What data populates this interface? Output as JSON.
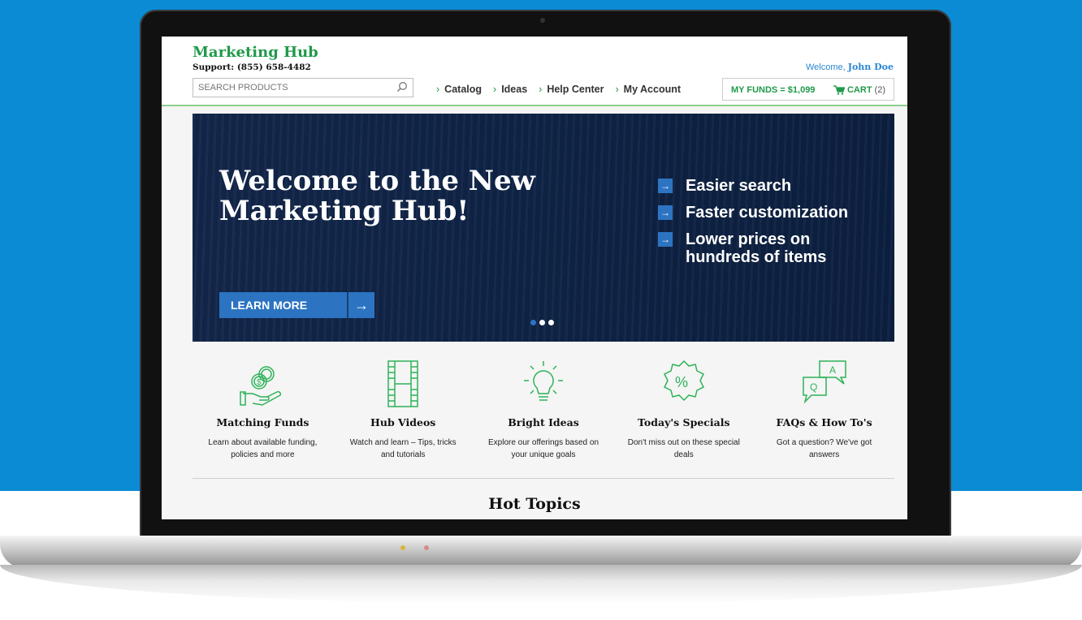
{
  "header": {
    "brand": "Marketing Hub",
    "support": "Support: (855) 658-4482",
    "search_placeholder": "SEARCH PRODUCTS",
    "welcome_prefix": "Welcome,",
    "user_name": "John Doe",
    "nav": [
      {
        "label": "Catalog"
      },
      {
        "label": "Ideas"
      },
      {
        "label": "Help Center"
      },
      {
        "label": "My Account"
      }
    ],
    "funds": "MY FUNDS = $1,099",
    "cart_label": "CART",
    "cart_count": "(2)"
  },
  "hero": {
    "title": "Welcome to the New Marketing Hub!",
    "cta": "LEARN MORE",
    "bullets": [
      {
        "text": "Easier search"
      },
      {
        "text": "Faster customization"
      },
      {
        "text": "Lower prices on hundreds of items"
      }
    ],
    "slides": 3,
    "active_slide": 1
  },
  "features": [
    {
      "title": "Matching Funds",
      "desc": "Learn about available funding, policies and more",
      "icon": "money-hand-icon"
    },
    {
      "title": "Hub Videos",
      "desc": "Watch and learn – Tips, tricks and tutorials",
      "icon": "film-strip-icon"
    },
    {
      "title": "Bright Ideas",
      "desc": "Explore our offerings based on your unique goals",
      "icon": "lightbulb-icon"
    },
    {
      "title": "Today's Specials",
      "desc": "Don't miss out on these special deals",
      "icon": "percent-badge-icon"
    },
    {
      "title": "FAQs & How To's",
      "desc": "Got a question? We've got answers",
      "icon": "qa-bubbles-icon"
    }
  ],
  "section_title": "Hot Topics",
  "colors": {
    "background": "#0b8bd3",
    "brand_green": "#1f9a4a",
    "hero_navy": "#0f2346",
    "accent_blue": "#2c74c2"
  }
}
